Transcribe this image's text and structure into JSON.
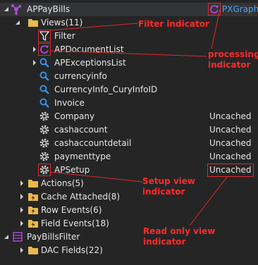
{
  "root": {
    "label": "APPayBills",
    "graph_label": "PXGraph"
  },
  "views": {
    "label": "Views(11)",
    "items": [
      {
        "label": "Filter",
        "icon": "filter-icon",
        "tag": ""
      },
      {
        "label": "APDocumentList",
        "icon": "refresh-icon",
        "tag": ""
      },
      {
        "label": "APExceptionsList",
        "icon": "search-icon",
        "tag": ""
      },
      {
        "label": "currencyinfo",
        "icon": "search-icon",
        "tag": ""
      },
      {
        "label": "CurrencyInfo_CuryInfoID",
        "icon": "search-icon",
        "tag": ""
      },
      {
        "label": "Invoice",
        "icon": "search-icon",
        "tag": ""
      },
      {
        "label": "Company",
        "icon": "gear-icon",
        "tag": "Uncached"
      },
      {
        "label": "cashaccount",
        "icon": "gear-icon",
        "tag": "Uncached"
      },
      {
        "label": "cashaccountdetail",
        "icon": "gear-icon",
        "tag": "Uncached"
      },
      {
        "label": "paymenttype",
        "icon": "gear-icon",
        "tag": "Uncached"
      },
      {
        "label": "APSetup",
        "icon": "gear-icon",
        "tag": "Uncached"
      }
    ]
  },
  "groups": [
    {
      "label": "Actions(5)",
      "icon": "folder-icon"
    },
    {
      "label": "Cache Attached(8)",
      "icon": "lightning-folder-icon"
    },
    {
      "label": "Row Events(6)",
      "icon": "lightning-folder-icon"
    },
    {
      "label": "Field Events(18)",
      "icon": "lightning-folder-icon"
    }
  ],
  "filter_node": {
    "label": "PayBillsFilter",
    "icon": "table-icon"
  },
  "dac_fields": {
    "label": "DAC Fields(22)",
    "icon": "folder-icon"
  },
  "annotations": {
    "filter": "Filter indicator",
    "processing": "processing\nindicator",
    "setup": "Setup view\nindicator",
    "readonly": "Read only view\nindicator"
  },
  "colors": {
    "background": "#252526",
    "annotation": "#ff2a2a",
    "folder": "#e8b94e",
    "search": "#3c8fe3",
    "graph": "#b04bd9",
    "processing": "#b04bd9"
  }
}
